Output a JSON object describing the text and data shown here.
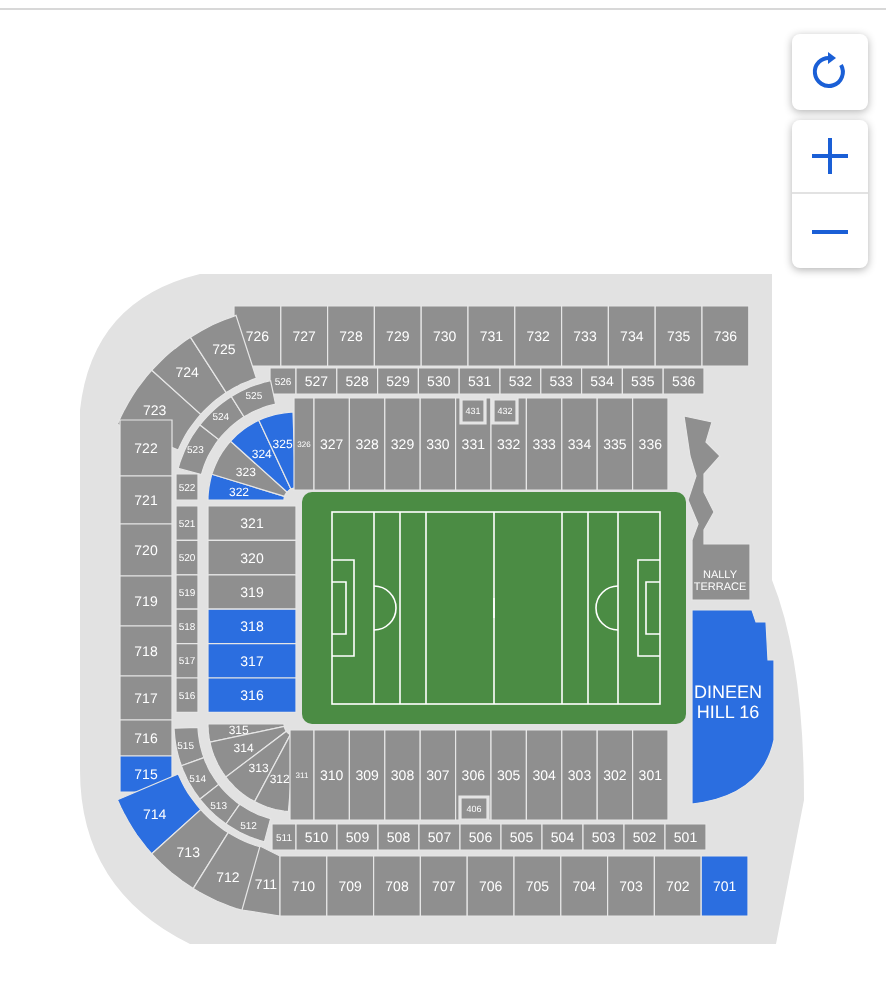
{
  "sections": [
    {
      "kind": "upper_top",
      "items": [
        {
          "label": "726",
          "selected": false
        },
        {
          "label": "727",
          "selected": false
        },
        {
          "label": "728",
          "selected": false
        },
        {
          "label": "729",
          "selected": false
        },
        {
          "label": "730",
          "selected": false
        },
        {
          "label": "731",
          "selected": false
        },
        {
          "label": "732",
          "selected": false
        },
        {
          "label": "733",
          "selected": false
        },
        {
          "label": "734",
          "selected": false
        },
        {
          "label": "735",
          "selected": false
        },
        {
          "label": "736",
          "selected": false
        }
      ]
    },
    {
      "kind": "upper_nw",
      "items": [
        {
          "label": "723",
          "selected": false
        },
        {
          "label": "724",
          "selected": false
        },
        {
          "label": "725",
          "selected": false
        }
      ]
    },
    {
      "kind": "mid_top",
      "items": [
        {
          "label": "526",
          "selected": false
        },
        {
          "label": "527",
          "selected": false
        },
        {
          "label": "528",
          "selected": false
        },
        {
          "label": "529",
          "selected": false
        },
        {
          "label": "530",
          "selected": false
        },
        {
          "label": "531",
          "selected": false
        },
        {
          "label": "532",
          "selected": false
        },
        {
          "label": "533",
          "selected": false
        },
        {
          "label": "534",
          "selected": false
        },
        {
          "label": "535",
          "selected": false
        },
        {
          "label": "536",
          "selected": false
        }
      ]
    },
    {
      "kind": "mid_nw",
      "items": [
        {
          "label": "523",
          "selected": false
        },
        {
          "label": "524",
          "selected": false
        },
        {
          "label": "525",
          "selected": false
        }
      ]
    },
    {
      "kind": "boxes_top",
      "items": [
        {
          "label": "431",
          "selected": false
        },
        {
          "label": "432",
          "selected": false
        }
      ]
    },
    {
      "kind": "lower_nw",
      "items": [
        {
          "label": "322",
          "selected": true
        },
        {
          "label": "323",
          "selected": false
        },
        {
          "label": "324",
          "selected": true
        },
        {
          "label": "325",
          "selected": true
        }
      ]
    },
    {
      "kind": "lower_top",
      "items": [
        {
          "label": "326",
          "selected": false
        },
        {
          "label": "327",
          "selected": false
        },
        {
          "label": "328",
          "selected": false
        },
        {
          "label": "329",
          "selected": false
        },
        {
          "label": "330",
          "selected": false
        },
        {
          "label": "331",
          "selected": false
        },
        {
          "label": "332",
          "selected": false
        },
        {
          "label": "333",
          "selected": false
        },
        {
          "label": "334",
          "selected": false
        },
        {
          "label": "335",
          "selected": false
        },
        {
          "label": "336",
          "selected": false
        }
      ]
    },
    {
      "kind": "upper_left",
      "items": [
        {
          "label": "722",
          "selected": false
        },
        {
          "label": "721",
          "selected": false
        },
        {
          "label": "720",
          "selected": false
        },
        {
          "label": "719",
          "selected": false
        },
        {
          "label": "718",
          "selected": false
        },
        {
          "label": "717",
          "selected": false
        },
        {
          "label": "716",
          "selected": false
        },
        {
          "label": "715",
          "selected": true
        }
      ]
    },
    {
      "kind": "mid_left",
      "items": [
        {
          "label": "522",
          "selected": false
        },
        {
          "label": "521",
          "selected": false
        },
        {
          "label": "520",
          "selected": false
        },
        {
          "label": "519",
          "selected": false
        },
        {
          "label": "518",
          "selected": false
        },
        {
          "label": "517",
          "selected": false
        },
        {
          "label": "516",
          "selected": false
        }
      ]
    },
    {
      "kind": "lower_left",
      "items": [
        {
          "label": "321",
          "selected": false
        },
        {
          "label": "320",
          "selected": false
        },
        {
          "label": "319",
          "selected": false
        },
        {
          "label": "318",
          "selected": true
        },
        {
          "label": "317",
          "selected": true
        },
        {
          "label": "316",
          "selected": true
        }
      ]
    },
    {
      "kind": "lower_sw",
      "items": [
        {
          "label": "315",
          "selected": false
        },
        {
          "label": "314",
          "selected": false
        },
        {
          "label": "313",
          "selected": false
        },
        {
          "label": "312",
          "selected": false
        }
      ]
    },
    {
      "kind": "lower_bottom",
      "items": [
        {
          "label": "311",
          "selected": false
        },
        {
          "label": "310",
          "selected": false
        },
        {
          "label": "309",
          "selected": false
        },
        {
          "label": "308",
          "selected": false
        },
        {
          "label": "307",
          "selected": false
        },
        {
          "label": "306",
          "selected": false
        },
        {
          "label": "305",
          "selected": false
        },
        {
          "label": "304",
          "selected": false
        },
        {
          "label": "303",
          "selected": false
        },
        {
          "label": "302",
          "selected": false
        },
        {
          "label": "301",
          "selected": false
        }
      ]
    },
    {
      "kind": "boxes_bottom",
      "items": [
        {
          "label": "406",
          "selected": false
        }
      ]
    },
    {
      "kind": "mid_sw",
      "items": [
        {
          "label": "515",
          "selected": false
        },
        {
          "label": "514",
          "selected": false
        },
        {
          "label": "513",
          "selected": false
        },
        {
          "label": "512",
          "selected": false
        }
      ]
    },
    {
      "kind": "mid_bottom",
      "items": [
        {
          "label": "511",
          "selected": false
        },
        {
          "label": "510",
          "selected": false
        },
        {
          "label": "509",
          "selected": false
        },
        {
          "label": "508",
          "selected": false
        },
        {
          "label": "507",
          "selected": false
        },
        {
          "label": "506",
          "selected": false
        },
        {
          "label": "505",
          "selected": false
        },
        {
          "label": "504",
          "selected": false
        },
        {
          "label": "503",
          "selected": false
        },
        {
          "label": "502",
          "selected": false
        },
        {
          "label": "501",
          "selected": false
        }
      ]
    },
    {
      "kind": "upper_sw",
      "items": [
        {
          "label": "714",
          "selected": true
        },
        {
          "label": "713",
          "selected": false
        },
        {
          "label": "712",
          "selected": false
        }
      ]
    },
    {
      "kind": "upper_bottom",
      "items": [
        {
          "label": "711",
          "selected": false
        },
        {
          "label": "710",
          "selected": false
        },
        {
          "label": "709",
          "selected": false
        },
        {
          "label": "708",
          "selected": false
        },
        {
          "label": "707",
          "selected": false
        },
        {
          "label": "706",
          "selected": false
        },
        {
          "label": "705",
          "selected": false
        },
        {
          "label": "704",
          "selected": false
        },
        {
          "label": "703",
          "selected": false
        },
        {
          "label": "702",
          "selected": false
        },
        {
          "label": "701",
          "selected": true
        }
      ]
    }
  ],
  "terraces": [
    {
      "kind": "nally",
      "label": "NALLY TERRACE",
      "selected": false
    },
    {
      "kind": "dineen",
      "label": "DINEEN HILL 16",
      "selected": true
    }
  ]
}
